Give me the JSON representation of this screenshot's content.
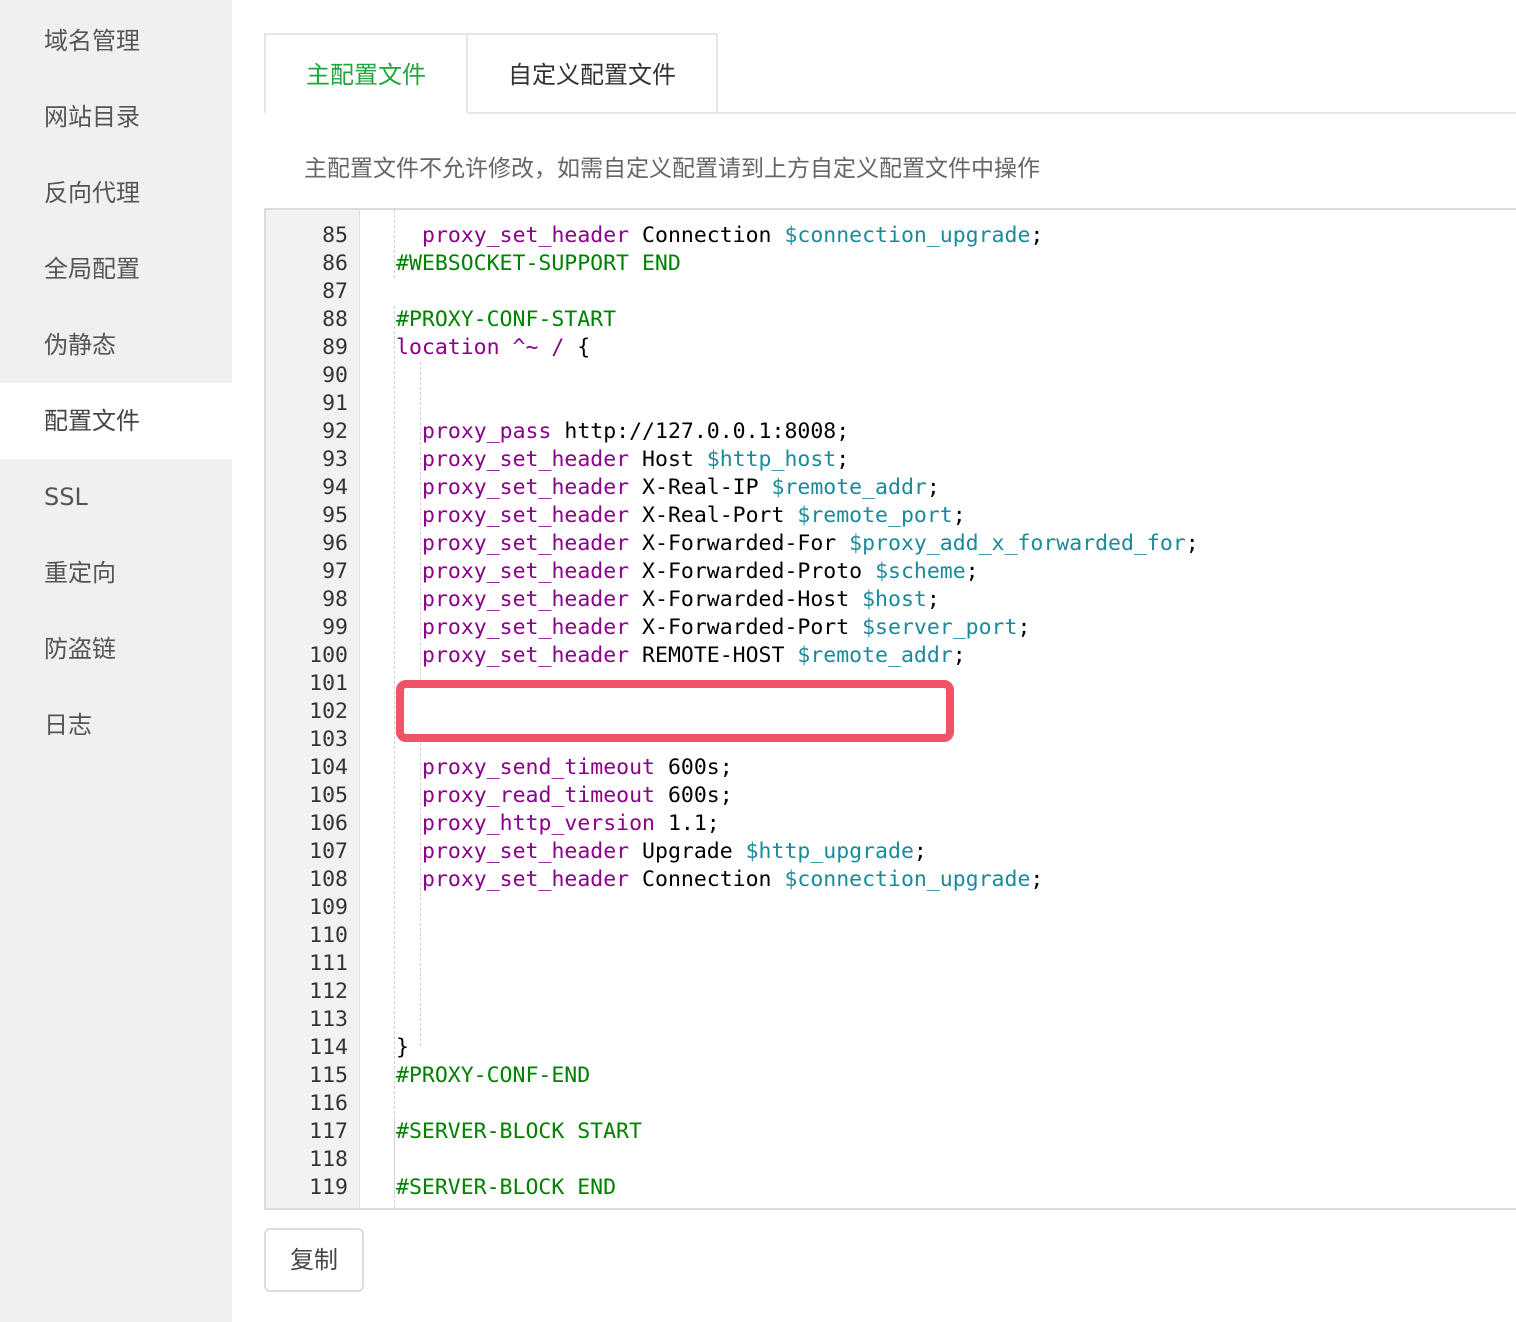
{
  "sidebar": {
    "items": [
      {
        "label": "域名管理"
      },
      {
        "label": "网站目录"
      },
      {
        "label": "反向代理"
      },
      {
        "label": "全局配置"
      },
      {
        "label": "伪静态"
      },
      {
        "label": "配置文件",
        "active": true
      },
      {
        "label": "SSL"
      },
      {
        "label": "重定向"
      },
      {
        "label": "防盗链"
      },
      {
        "label": "日志"
      }
    ]
  },
  "tabs": [
    {
      "label": "主配置文件",
      "active": true
    },
    {
      "label": "自定义配置文件"
    }
  ],
  "notice": "主配置文件不允许修改，如需自定义配置请到上方自定义配置文件中操作",
  "editor": {
    "lines": [
      {
        "n": "85",
        "indent": 2,
        "tokens": [
          [
            "kw",
            "proxy_set_header"
          ],
          [
            "t",
            " Connection "
          ],
          [
            "var",
            "$connection_upgrade"
          ],
          [
            "t",
            ";"
          ]
        ]
      },
      {
        "n": "86",
        "indent": 1,
        "tokens": [
          [
            "cmt",
            "#WEBSOCKET-SUPPORT END"
          ]
        ]
      },
      {
        "n": "87",
        "indent": 1,
        "tokens": []
      },
      {
        "n": "88",
        "indent": 1,
        "tokens": [
          [
            "cmt",
            "#PROXY-CONF-START"
          ]
        ]
      },
      {
        "n": "89",
        "indent": 1,
        "tokens": [
          [
            "kw",
            "location"
          ],
          [
            "t",
            " "
          ],
          [
            "kw",
            "^~ /"
          ],
          [
            "t",
            " {"
          ]
        ]
      },
      {
        "n": "90",
        "indent": 2,
        "tokens": []
      },
      {
        "n": "91",
        "indent": 2,
        "tokens": []
      },
      {
        "n": "92",
        "indent": 2,
        "tokens": [
          [
            "kw",
            "proxy_pass"
          ],
          [
            "t",
            " http://127.0.0.1:8008;"
          ]
        ]
      },
      {
        "n": "93",
        "indent": 2,
        "tokens": [
          [
            "kw",
            "proxy_set_header"
          ],
          [
            "t",
            " Host "
          ],
          [
            "var",
            "$http_host"
          ],
          [
            "t",
            ";"
          ]
        ]
      },
      {
        "n": "94",
        "indent": 2,
        "tokens": [
          [
            "kw",
            "proxy_set_header"
          ],
          [
            "t",
            " X-Real-IP "
          ],
          [
            "var",
            "$remote_addr"
          ],
          [
            "t",
            ";"
          ]
        ]
      },
      {
        "n": "95",
        "indent": 2,
        "tokens": [
          [
            "kw",
            "proxy_set_header"
          ],
          [
            "t",
            " X-Real-Port "
          ],
          [
            "var",
            "$remote_port"
          ],
          [
            "t",
            ";"
          ]
        ]
      },
      {
        "n": "96",
        "indent": 2,
        "tokens": [
          [
            "kw",
            "proxy_set_header"
          ],
          [
            "t",
            " X-Forwarded-For "
          ],
          [
            "var",
            "$proxy_add_x_forwarded_for"
          ],
          [
            "t",
            ";"
          ]
        ]
      },
      {
        "n": "97",
        "indent": 2,
        "tokens": [
          [
            "kw",
            "proxy_set_header"
          ],
          [
            "t",
            " X-Forwarded-Proto "
          ],
          [
            "var",
            "$scheme"
          ],
          [
            "t",
            ";"
          ]
        ]
      },
      {
        "n": "98",
        "indent": 2,
        "tokens": [
          [
            "kw",
            "proxy_set_header"
          ],
          [
            "t",
            " X-Forwarded-Host "
          ],
          [
            "var",
            "$host"
          ],
          [
            "t",
            ";"
          ]
        ]
      },
      {
        "n": "99",
        "indent": 2,
        "tokens": [
          [
            "kw",
            "proxy_set_header"
          ],
          [
            "t",
            " X-Forwarded-Port "
          ],
          [
            "var",
            "$server_port"
          ],
          [
            "t",
            ";"
          ]
        ]
      },
      {
        "n": "100",
        "indent": 2,
        "tokens": [
          [
            "kw",
            "proxy_set_header"
          ],
          [
            "t",
            " REMOTE-HOST "
          ],
          [
            "var",
            "$remote_addr"
          ],
          [
            "t",
            ";"
          ]
        ]
      },
      {
        "n": "101",
        "indent": 2,
        "tokens": []
      },
      {
        "n": "102",
        "indent": 2,
        "tokens": []
      },
      {
        "n": "103",
        "indent": 2,
        "tokens": []
      },
      {
        "n": "104",
        "indent": 2,
        "tokens": [
          [
            "kw",
            "proxy_send_timeout"
          ],
          [
            "t",
            " 600s;"
          ]
        ]
      },
      {
        "n": "105",
        "indent": 2,
        "tokens": [
          [
            "kw",
            "proxy_read_timeout"
          ],
          [
            "t",
            " 600s;"
          ]
        ]
      },
      {
        "n": "106",
        "indent": 2,
        "tokens": [
          [
            "kw",
            "proxy_http_version"
          ],
          [
            "t",
            " 1.1;"
          ]
        ]
      },
      {
        "n": "107",
        "indent": 2,
        "tokens": [
          [
            "kw",
            "proxy_set_header"
          ],
          [
            "t",
            " Upgrade "
          ],
          [
            "var",
            "$http_upgrade"
          ],
          [
            "t",
            ";"
          ]
        ]
      },
      {
        "n": "108",
        "indent": 2,
        "tokens": [
          [
            "kw",
            "proxy_set_header"
          ],
          [
            "t",
            " Connection "
          ],
          [
            "var",
            "$connection_upgrade"
          ],
          [
            "t",
            ";"
          ]
        ]
      },
      {
        "n": "109",
        "indent": 2,
        "tokens": []
      },
      {
        "n": "110",
        "indent": 2,
        "tokens": []
      },
      {
        "n": "111",
        "indent": 2,
        "tokens": []
      },
      {
        "n": "112",
        "indent": 2,
        "tokens": []
      },
      {
        "n": "113",
        "indent": 2,
        "tokens": []
      },
      {
        "n": "114",
        "indent": 1,
        "tokens": [
          [
            "t",
            "}"
          ]
        ]
      },
      {
        "n": "115",
        "indent": 1,
        "tokens": [
          [
            "cmt",
            "#PROXY-CONF-END"
          ]
        ]
      },
      {
        "n": "116",
        "indent": 1,
        "tokens": []
      },
      {
        "n": "117",
        "indent": 1,
        "tokens": [
          [
            "cmt",
            "#SERVER-BLOCK START"
          ]
        ]
      },
      {
        "n": "118",
        "indent": 1,
        "tokens": []
      },
      {
        "n": "119",
        "indent": 1,
        "tokens": [
          [
            "cmt",
            "#SERVER-BLOCK END"
          ]
        ]
      }
    ]
  },
  "copy_button": "复制",
  "colors": {
    "accent": "#20a53a",
    "keyword": "#8b008b",
    "variable": "#1a8a9a",
    "comment": "#008000",
    "highlight": "#f25266"
  }
}
